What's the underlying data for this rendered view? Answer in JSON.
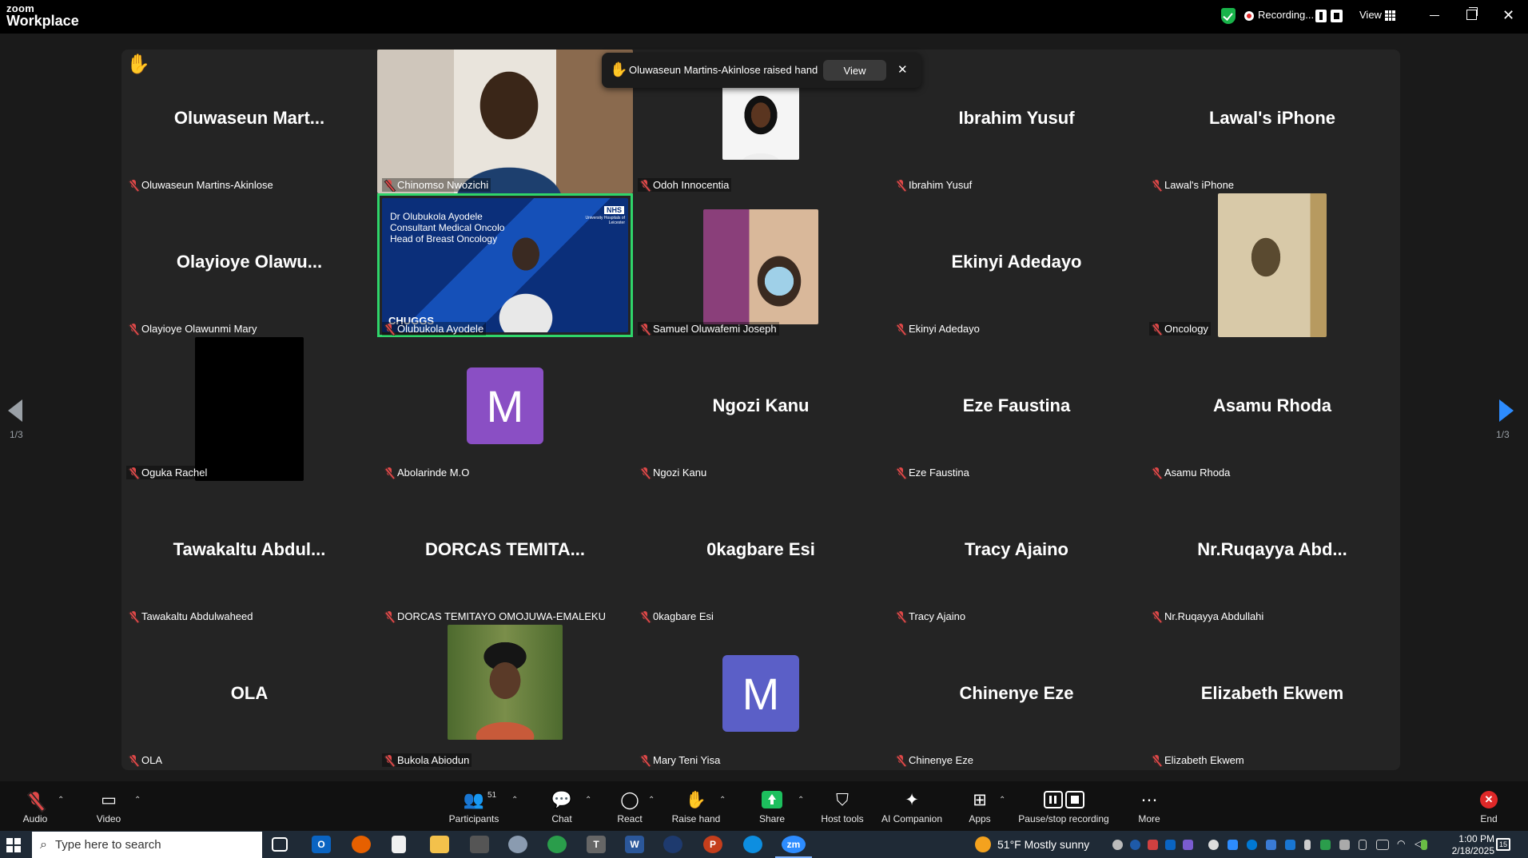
{
  "app": {
    "brand_line1": "zoom",
    "brand_line2": "Workplace"
  },
  "titlebar": {
    "recording_label": "Recording...",
    "view_label": "View"
  },
  "notification": {
    "text": "Oluwaseun Martins-Akinlose raised hand",
    "view_button": "View"
  },
  "pagination": {
    "left": "1/3",
    "right": "1/3"
  },
  "tiles": [
    {
      "name": "Oluwaseun Martins-Akinlose",
      "display": "Oluwaseun Mart...",
      "kind": "name"
    },
    {
      "name": "Chinomso Nwozichi",
      "display": "",
      "kind": "video"
    },
    {
      "name": "Odoh Innocentia",
      "display": "",
      "kind": "photo"
    },
    {
      "name": "Ibrahim Yusuf",
      "display": "Ibrahim Yusuf",
      "kind": "name"
    },
    {
      "name": "Lawal's iPhone",
      "display": "Lawal's iPhone",
      "kind": "name"
    },
    {
      "name": "Olayioye Olawunmi Mary",
      "display": "Olayioye Olawu...",
      "kind": "name"
    },
    {
      "name": "Olubukola Ayodele",
      "display": "",
      "kind": "video",
      "active_speaker": true
    },
    {
      "name": "Samuel Oluwafemi Joseph",
      "display": "",
      "kind": "video"
    },
    {
      "name": "Ekinyi Adedayo",
      "display": "Ekinyi Adedayo",
      "kind": "name"
    },
    {
      "name": "Oncology",
      "display": "",
      "kind": "video"
    },
    {
      "name": "Oguka Rachel",
      "display": "",
      "kind": "video"
    },
    {
      "name": "Abolarinde M.O",
      "display": "M",
      "kind": "avatar",
      "color": "#8a4fc4"
    },
    {
      "name": "Ngozi Kanu",
      "display": "Ngozi Kanu",
      "kind": "name"
    },
    {
      "name": "Eze Faustina",
      "display": "Eze Faustina",
      "kind": "name"
    },
    {
      "name": "Asamu Rhoda",
      "display": "Asamu Rhoda",
      "kind": "name"
    },
    {
      "name": "Tawakaltu Abdulwaheed",
      "display": "Tawakaltu Abdul...",
      "kind": "name"
    },
    {
      "name": "DORCAS TEMITAYO OMOJUWA-EMALEKU",
      "display": "DORCAS TEMITA...",
      "kind": "name"
    },
    {
      "name": "0kagbare Esi",
      "display": "0kagbare Esi",
      "kind": "name"
    },
    {
      "name": "Tracy Ajaino",
      "display": "Tracy Ajaino",
      "kind": "name"
    },
    {
      "name": "Nr.Ruqayya Abdullahi",
      "display": "Nr.Ruqayya Abd...",
      "kind": "name"
    },
    {
      "name": "OLA",
      "display": "OLA",
      "kind": "name"
    },
    {
      "name": "Bukola Abiodun",
      "display": "",
      "kind": "photo"
    },
    {
      "name": "Mary Teni Yisa",
      "display": "M",
      "kind": "avatar",
      "color": "#5b5fc7"
    },
    {
      "name": "Chinenye Eze",
      "display": "Chinenye Eze",
      "kind": "name"
    },
    {
      "name": "Elizabeth Ekwem",
      "display": "Elizabeth Ekwem",
      "kind": "name"
    }
  ],
  "slide_text": {
    "line1": "Dr Olubukola Ayodele",
    "line2": "Consultant Medical Oncolo",
    "line3": "Head of Breast Oncology",
    "footer": "CHUGGS",
    "badge": "NHS",
    "org": "University Hospitals of Leicester"
  },
  "toolbar": {
    "audio": "Audio",
    "video": "Video",
    "participants": "Participants",
    "participants_count": "51",
    "chat": "Chat",
    "react": "React",
    "raise_hand": "Raise hand",
    "share": "Share",
    "host_tools": "Host tools",
    "ai_companion": "AI Companion",
    "apps": "Apps",
    "pause_stop": "Pause/stop recording",
    "more": "More",
    "end": "End"
  },
  "taskbar": {
    "search_placeholder": "Type here to search",
    "weather": "51°F  Mostly sunny",
    "time": "1:00 PM",
    "date": "2/18/2025",
    "notif_count": "15"
  },
  "colors": {
    "accent": "#2d8cff",
    "active_speaker": "#2fd56a",
    "muted": "#e04848",
    "share": "#1dbf5e",
    "end": "#e02828"
  }
}
